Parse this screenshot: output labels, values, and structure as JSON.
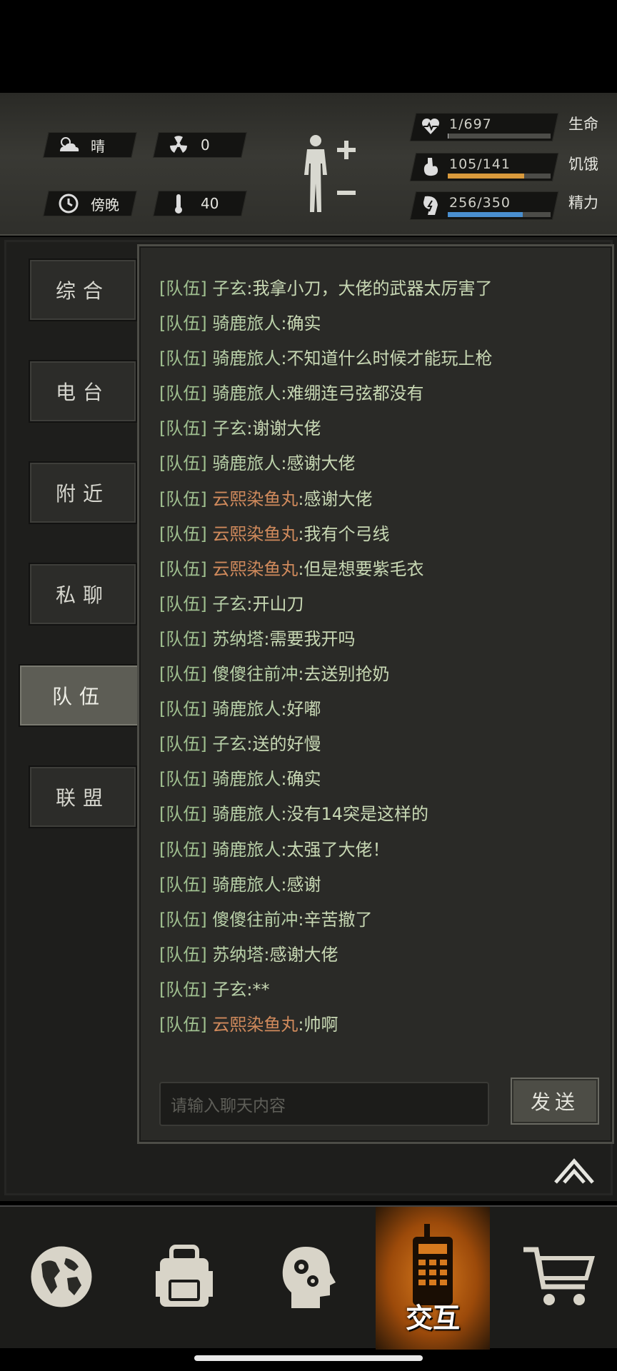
{
  "hud": {
    "weather": "晴",
    "radiation": "0",
    "time_of_day": "傍晚",
    "temperature": "40",
    "vitals": [
      {
        "value": "1/697",
        "label": "生命",
        "fraction": 0.0014,
        "color": "#c0c0c0",
        "icon": "heart-icon"
      },
      {
        "value": "105/141",
        "label": "饥饿",
        "fraction": 0.745,
        "color": "#d99a3c",
        "icon": "stomach-icon"
      },
      {
        "value": "256/350",
        "label": "精力",
        "fraction": 0.731,
        "color": "#4a8fcf",
        "icon": "energy-icon"
      }
    ]
  },
  "tabs": [
    {
      "label": "综合",
      "active": false
    },
    {
      "label": "电台",
      "active": false
    },
    {
      "label": "附近",
      "active": false
    },
    {
      "label": "私聊",
      "active": false
    },
    {
      "label": "队伍",
      "active": true
    },
    {
      "label": "联盟",
      "active": false
    }
  ],
  "chat": {
    "messages": [
      {
        "channel": "[队伍]",
        "sender": "子玄",
        "text": ":我拿小刀，大佬的武器太厉害了",
        "alt": false
      },
      {
        "channel": "[队伍]",
        "sender": "骑鹿旅人",
        "text": ":确实",
        "alt": false
      },
      {
        "channel": "[队伍]",
        "sender": "骑鹿旅人",
        "text": ":不知道什么时候才能玩上枪",
        "alt": false
      },
      {
        "channel": "[队伍]",
        "sender": "骑鹿旅人",
        "text": ":难绷连弓弦都没有",
        "alt": false
      },
      {
        "channel": "[队伍]",
        "sender": "子玄",
        "text": ":谢谢大佬",
        "alt": false
      },
      {
        "channel": "[队伍]",
        "sender": "骑鹿旅人",
        "text": ":感谢大佬",
        "alt": false
      },
      {
        "channel": "[队伍]",
        "sender": "云熙染鱼丸",
        "text": ":感谢大佬",
        "alt": true
      },
      {
        "channel": "[队伍]",
        "sender": "云熙染鱼丸",
        "text": ":我有个弓线",
        "alt": true
      },
      {
        "channel": "[队伍]",
        "sender": "云熙染鱼丸",
        "text": ":但是想要紫毛衣",
        "alt": true
      },
      {
        "channel": "[队伍]",
        "sender": "子玄",
        "text": ":开山刀",
        "alt": false
      },
      {
        "channel": "[队伍]",
        "sender": "苏纳塔",
        "text": ":需要我开吗",
        "alt": false
      },
      {
        "channel": "[队伍]",
        "sender": "傻傻往前冲",
        "text": ":去送别抢奶",
        "alt": false
      },
      {
        "channel": "[队伍]",
        "sender": "骑鹿旅人",
        "text": ":好嘟",
        "alt": false
      },
      {
        "channel": "[队伍]",
        "sender": "子玄",
        "text": ":送的好慢",
        "alt": false
      },
      {
        "channel": "[队伍]",
        "sender": "骑鹿旅人",
        "text": ":确实",
        "alt": false
      },
      {
        "channel": "[队伍]",
        "sender": "骑鹿旅人",
        "text": ":没有14突是这样的",
        "alt": false
      },
      {
        "channel": "[队伍]",
        "sender": "骑鹿旅人",
        "text": ":太强了大佬！",
        "alt": false
      },
      {
        "channel": "[队伍]",
        "sender": "骑鹿旅人",
        "text": ":感谢",
        "alt": false
      },
      {
        "channel": "[队伍]",
        "sender": "傻傻往前冲",
        "text": ":辛苦撤了",
        "alt": false
      },
      {
        "channel": "[队伍]",
        "sender": "苏纳塔",
        "text": ":感谢大佬",
        "alt": false
      },
      {
        "channel": "[队伍]",
        "sender": "子玄",
        "text": ":**",
        "alt": false
      },
      {
        "channel": "[队伍]",
        "sender": "云熙染鱼丸",
        "text": ":帅啊",
        "alt": true
      }
    ],
    "input_placeholder": "请输入聊天内容",
    "send_label": "发送"
  },
  "nav": {
    "items": [
      {
        "icon": "globe-icon",
        "label": ""
      },
      {
        "icon": "backpack-icon",
        "label": ""
      },
      {
        "icon": "skills-head-icon",
        "label": ""
      },
      {
        "icon": "radio-icon",
        "label": "交互",
        "active": true
      },
      {
        "icon": "shopping-cart-icon",
        "label": ""
      }
    ]
  }
}
